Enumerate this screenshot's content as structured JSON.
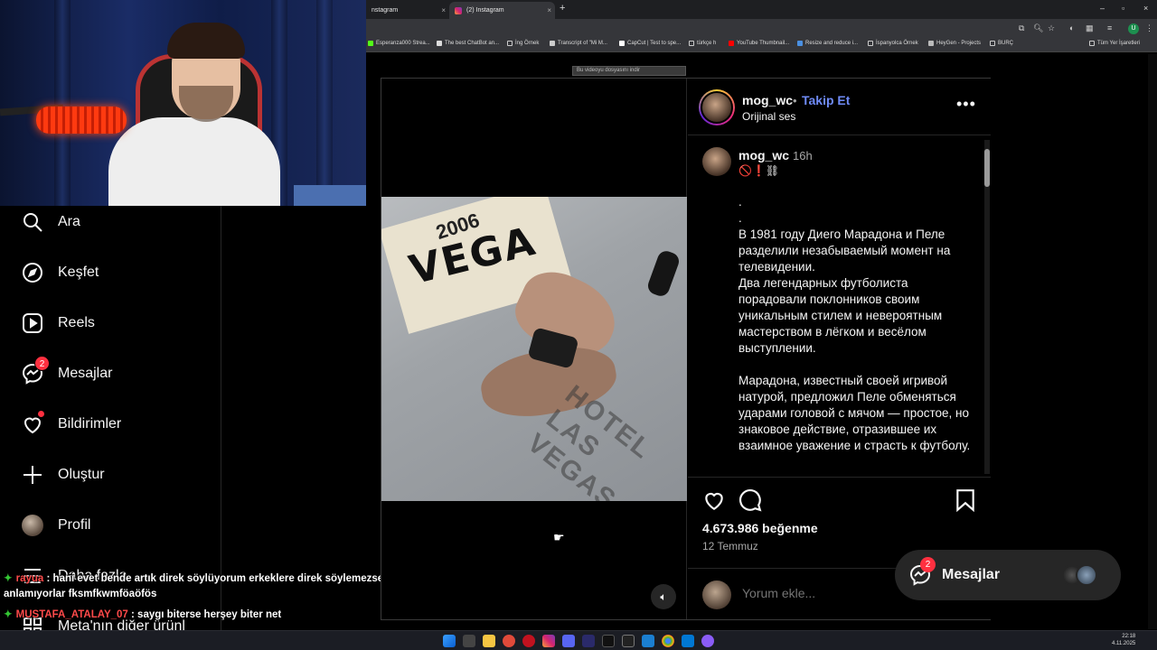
{
  "browser": {
    "tabs": [
      {
        "label": "nstagram",
        "close": "×"
      },
      {
        "label": "(2) Instagram",
        "close": "×"
      }
    ],
    "new_tab": "+",
    "window_controls": [
      "–",
      "▫",
      "×"
    ],
    "bookmarks": [
      "Esperanza000 Strea...",
      "The best ChatBot an...",
      "İng Örnek",
      "Transcript of \"Mi M...",
      "CapCut | Test to spe...",
      "türkçe h",
      "YouTube Thumbnail...",
      "Resize and reduce i...",
      "İspanyolca Örnek",
      "HeyGen - Projects",
      "BURÇ",
      "Tüm Yer İşaretleri"
    ],
    "profile_initial": "U",
    "download_bar": "Bu videoyu dosyasını indir"
  },
  "sidebar": {
    "items": [
      {
        "label": "Ara",
        "icon": "search-icon"
      },
      {
        "label": "Keşfet",
        "icon": "compass-icon"
      },
      {
        "label": "Reels",
        "icon": "reels-icon"
      },
      {
        "label": "Mesajlar",
        "icon": "messenger-icon",
        "badge": "2"
      },
      {
        "label": "Bildirimler",
        "icon": "heart-icon"
      },
      {
        "label": "Oluştur",
        "icon": "plus-icon"
      },
      {
        "label": "Profil",
        "icon": "avatar"
      },
      {
        "label": "Daha fazla",
        "icon": "menu-icon"
      },
      {
        "label": "Meta'nın diğer ürünl",
        "icon": "meta-icon"
      }
    ]
  },
  "chat": {
    "lines": [
      {
        "user": "rayua",
        "text": " : hani evet bende artık direk söylüyorum erkeklere direk söylemezsem"
      },
      {
        "user": "",
        "text": "anlamıyorlar fksmfkwmföaöfös"
      },
      {
        "user": "MUSTAFA_ATALAY_07",
        "text": " : saygı biterse herşey biter net"
      }
    ]
  },
  "post": {
    "video_banner_text": "VEGA",
    "video_banner_small": "2006",
    "video_logo": "HOTEL LAS VEGAS",
    "header": {
      "username": "mog_wc",
      "dot": "•",
      "follow": "Takip Et",
      "audio": "Orijinal ses",
      "more": "•••"
    },
    "caption": {
      "username": "mog_wc",
      "time": "16h",
      "emojis": "🚫❗⛓",
      "text": ".\n.\nВ 1981 году Диего Марадона и Пеле разделили незабываемый момент на телевидении.\nДва легендарных футболиста порадовали поклонников своим уникальным стилем и невероятным мастерством в лёгком и весёлом выступлении.\n\nМарадона, известный своей игривой натурой, предложил Пеле обменяться ударами головой с мячом — простое, но знаковое действие, отразившее их взаимное уважение и страсть к футболу."
    },
    "likes": "4.673.986 beğenme",
    "date": "12 Temmuz",
    "comment_placeholder": "Yorum ekle..."
  },
  "messages_pill": {
    "label": "Mesajlar",
    "badge": "2"
  },
  "taskbar": {
    "time": "22:18",
    "date": "4.11.2025"
  },
  "colors": {
    "follow": "#6f8bf7",
    "badge": "#ff3040",
    "background": "#000000"
  }
}
